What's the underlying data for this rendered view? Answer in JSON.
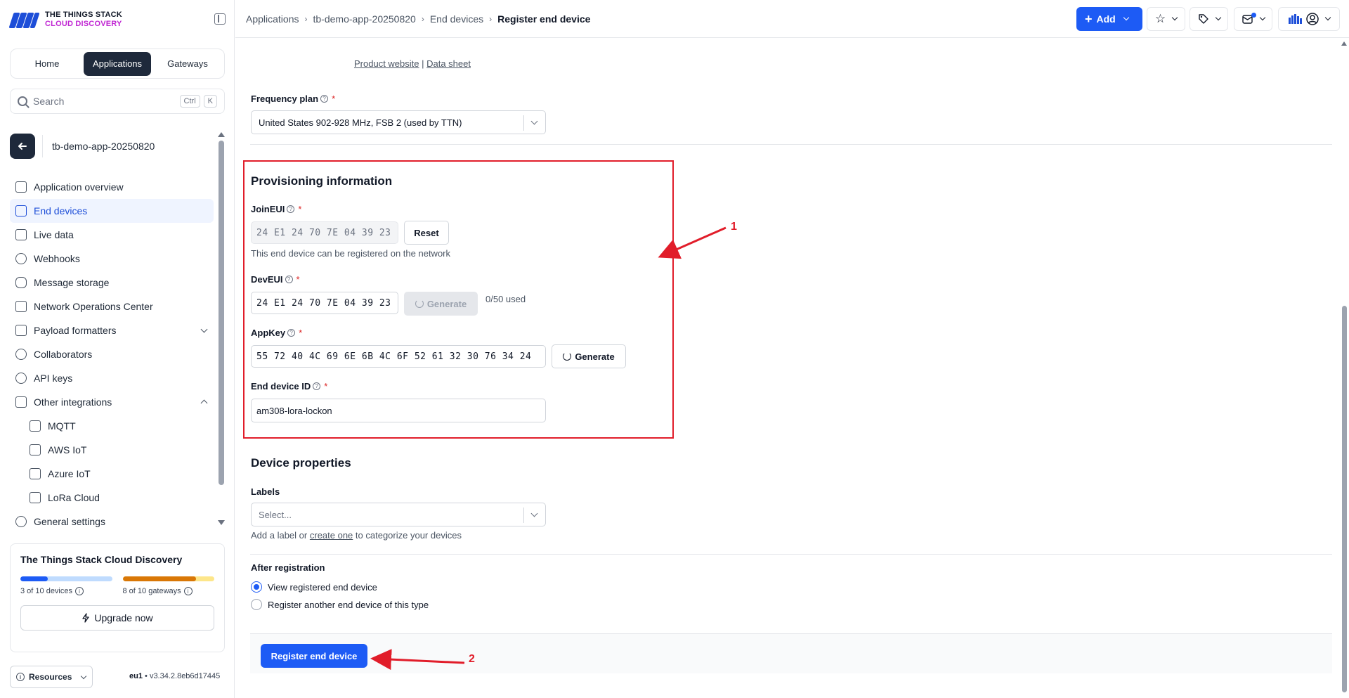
{
  "brand": {
    "line1": "THE THINGS STACK",
    "line2": "CLOUD DISCOVERY"
  },
  "nav_tabs": [
    "Home",
    "Applications",
    "Gateways"
  ],
  "search": {
    "placeholder": "Search",
    "key1": "Ctrl",
    "key2": "K"
  },
  "application": {
    "name": "tb-demo-app-20250820"
  },
  "sidebar_items": [
    {
      "label": "Application overview",
      "icon": "overview-icon"
    },
    {
      "label": "End devices",
      "icon": "chip-icon"
    },
    {
      "label": "Live data",
      "icon": "list-icon"
    },
    {
      "label": "Webhooks",
      "icon": "webhook-icon"
    },
    {
      "label": "Message storage",
      "icon": "database-icon"
    },
    {
      "label": "Network Operations Center",
      "icon": "chart-icon"
    },
    {
      "label": "Payload formatters",
      "icon": "code-icon"
    },
    {
      "label": "Collaborators",
      "icon": "users-icon"
    },
    {
      "label": "API keys",
      "icon": "key-icon"
    },
    {
      "label": "Other integrations",
      "icon": "integrations-icon"
    },
    {
      "label": "MQTT",
      "icon": "puzzle-icon"
    },
    {
      "label": "AWS IoT",
      "icon": "puzzle-icon"
    },
    {
      "label": "Azure IoT",
      "icon": "puzzle-icon"
    },
    {
      "label": "LoRa Cloud",
      "icon": "puzzle-icon"
    },
    {
      "label": "General settings",
      "icon": "gear-icon"
    }
  ],
  "plan": {
    "title": "The Things Stack Cloud Discovery",
    "devices_label": "3 of 10 devices",
    "devices_fraction": 0.3,
    "gateways_label": "8 of 10 gateways",
    "gateways_fraction": 0.8,
    "upgrade_label": "Upgrade now"
  },
  "footer": {
    "resources_label": "Resources",
    "region": "eu1",
    "version": "v3.34.2.8eb6d17445"
  },
  "breadcrumb": [
    "Applications",
    "tb-demo-app-20250820",
    "End devices",
    "Register end device"
  ],
  "header": {
    "add_label": "Add"
  },
  "form": {
    "product_website": "Product website",
    "data_sheet": "Data sheet",
    "frequency_plan_label": "Frequency plan",
    "frequency_plan_value": "United States 902-928 MHz, FSB 2 (used by TTN)",
    "provisioning_title": "Provisioning information",
    "joineui_label": "JoinEUI",
    "joineui_value": "24 E1 24 70 7E 04 39 23",
    "reset_label": "Reset",
    "joineui_helper": "This end device can be registered on the network",
    "deveui_label": "DevEUI",
    "deveui_value": "24 E1 24 70 7E 04 39 23",
    "generate_label": "Generate",
    "deveui_usage": "0/50 used",
    "appkey_label": "AppKey",
    "appkey_value": "55 72 40 4C 69 6E 6B 4C 6F 52 61 32 30 76 34 24",
    "device_id_label": "End device ID",
    "device_id_value": "am308-lora-lockon",
    "device_properties_title": "Device properties",
    "labels_label": "Labels",
    "labels_placeholder": "Select...",
    "labels_helper_pre": "Add a label or",
    "labels_helper_link": "create one",
    "labels_helper_post": "to categorize your devices",
    "after_registration_label": "After registration",
    "radio_view": "View registered end device",
    "radio_another": "Register another end device of this type",
    "submit_label": "Register end device"
  },
  "annotations": {
    "label1": "1",
    "label2": "2",
    "color": "#e11d2a"
  },
  "colors": {
    "primary": "#1d5bf5",
    "dark": "#1e293b",
    "accent_brand": "#c026d3"
  }
}
